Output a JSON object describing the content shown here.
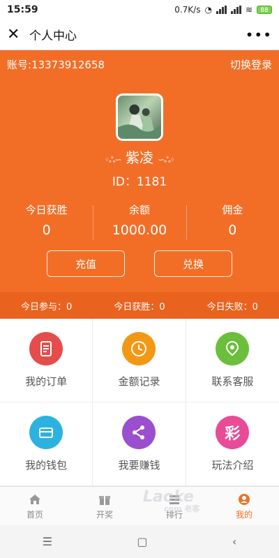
{
  "status_bar": {
    "time": "15:59",
    "net_speed": "0.7K/s",
    "battery": "88"
  },
  "nav": {
    "title": "个人中心",
    "close_icon": "close-icon",
    "more_icon": "more-icon"
  },
  "profile": {
    "account": "账号:13373912658",
    "switch_login": "切换登录",
    "username": "紫凌",
    "id_text": "ID：1181"
  },
  "stats": [
    {
      "label": "今日获胜",
      "value": "0"
    },
    {
      "label": "余额",
      "value": "1000.00"
    },
    {
      "label": "佣金",
      "value": "0"
    }
  ],
  "buttons": {
    "recharge": "充值",
    "exchange": "兑换"
  },
  "today": {
    "participate": "今日参与：0",
    "win": "今日获胜：0",
    "lose": "今日失败：0"
  },
  "menu": [
    {
      "label": "我的订单",
      "icon": "order-icon",
      "color": "#e44d4a"
    },
    {
      "label": "金额记录",
      "icon": "clock-icon",
      "color": "#f39814"
    },
    {
      "label": "联系客服",
      "icon": "location-icon",
      "color": "#6cbf3c"
    },
    {
      "label": "我的钱包",
      "icon": "wallet-icon",
      "color": "#2cb2e0"
    },
    {
      "label": "我要赚钱",
      "icon": "share-icon",
      "color": "#9a4fce"
    },
    {
      "label": "玩法介绍",
      "icon": "cai-icon",
      "color": "#e84c97",
      "glyph": "彩"
    }
  ],
  "tabs": [
    {
      "label": "首页",
      "icon": "home-icon"
    },
    {
      "label": "开奖",
      "icon": "gift-icon"
    },
    {
      "label": "排行",
      "icon": "list-icon"
    },
    {
      "label": "我的",
      "icon": "user-icon"
    }
  ],
  "watermark": {
    "brand": "Laoke",
    "sub": "com 老客"
  },
  "colors": {
    "accent": "#f26e27",
    "today_bar": "#e9631f"
  }
}
